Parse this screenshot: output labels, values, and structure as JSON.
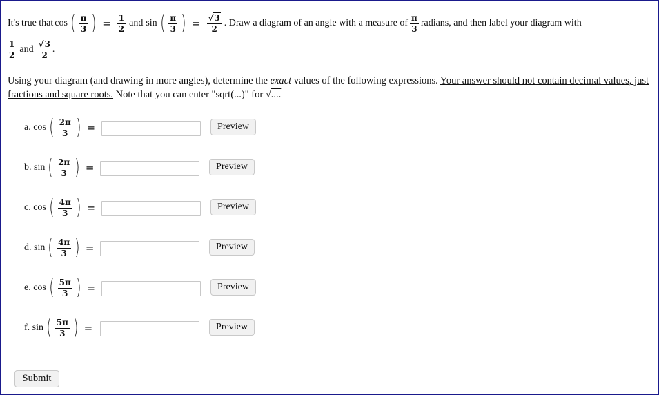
{
  "intro": {
    "t1": "It's true that",
    "cos": "cos",
    "sin": "sin",
    "pi": "π",
    "three": "3",
    "one": "1",
    "two": "2",
    "sqrt3": "3",
    "and": "and",
    "t2": ". Draw a diagram of an angle with a measure of",
    "t3": "radians, and then label your diagram with",
    "period": "."
  },
  "instructions": {
    "t1": "Using your diagram (and drawing in more angles), determine the ",
    "exact": "exact",
    "t2": " values of the following expressions. ",
    "underlined": "Your answer should not contain decimal values, just fractions and square roots.",
    "t3": " Note that you can enter \"sqrt(...)\" for ",
    "sqrt_symbol": "√",
    "ellipsis": "...."
  },
  "problems": [
    {
      "label": "a. cos",
      "num": "2π",
      "den": "3",
      "value": "",
      "preview_label": "Preview"
    },
    {
      "label": "b. sin",
      "num": "2π",
      "den": "3",
      "value": "",
      "preview_label": "Preview"
    },
    {
      "label": "c. cos",
      "num": "4π",
      "den": "3",
      "value": "",
      "preview_label": "Preview"
    },
    {
      "label": "d. sin",
      "num": "4π",
      "den": "3",
      "value": "",
      "preview_label": "Preview"
    },
    {
      "label": "e. cos",
      "num": "5π",
      "den": "3",
      "value": "",
      "preview_label": "Preview"
    },
    {
      "label": "f. sin",
      "num": "5π",
      "den": "3",
      "value": "",
      "preview_label": "Preview"
    }
  ],
  "eq_sign": "=",
  "submit_label": "Submit"
}
